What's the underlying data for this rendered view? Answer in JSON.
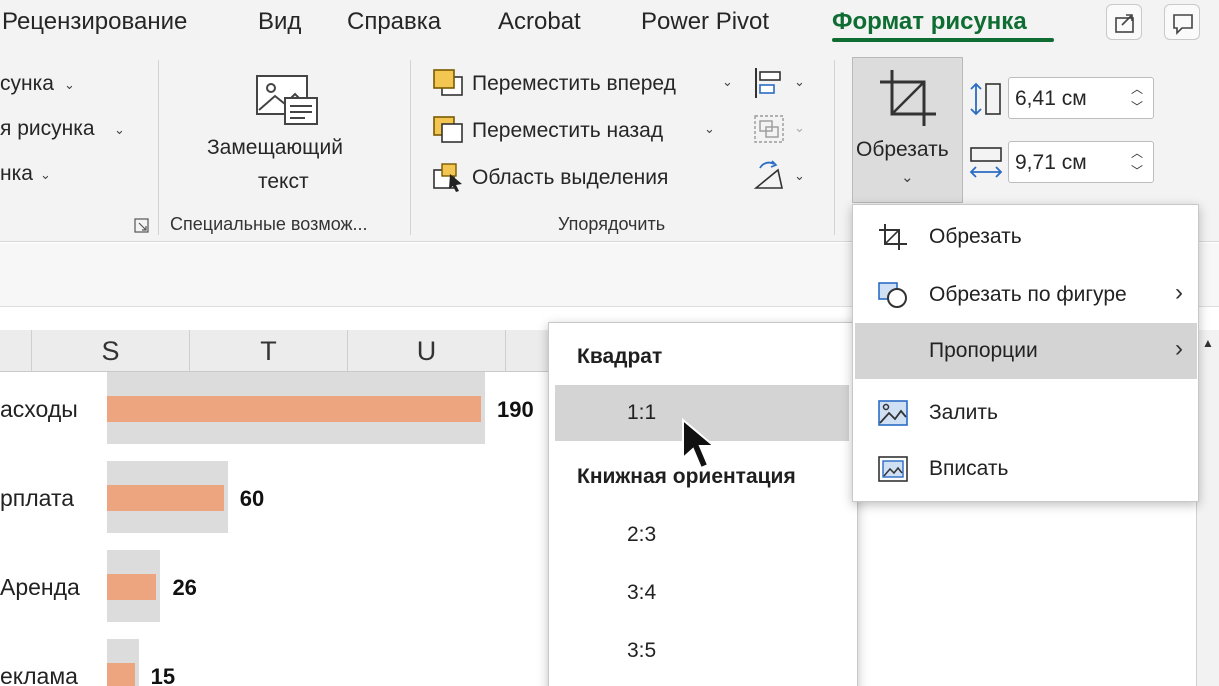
{
  "tabs": [
    {
      "label": "Рецензирование"
    },
    {
      "label": "Вид"
    },
    {
      "label": "Справка"
    },
    {
      "label": "Acrobat"
    },
    {
      "label": "Power Pivot"
    },
    {
      "label": "Формат рисунка"
    }
  ],
  "ribbon": {
    "left_items": [
      "сунка",
      "я рисунка",
      "нка"
    ],
    "alt_text": {
      "line1": "Замещающий",
      "line2": "текст"
    },
    "accessibility_group_label": "Специальные возмож...",
    "arrange": {
      "bring_forward": "Переместить вперед",
      "send_backward": "Переместить назад",
      "selection_pane": "Область выделения",
      "group_label": "Упорядочить"
    },
    "crop_button_label": "Обрезать",
    "height_value": "6,41 см",
    "width_value": "9,71 см"
  },
  "sheet": {
    "columns": [
      "S",
      "T",
      "U"
    ]
  },
  "chart_data": {
    "type": "bar",
    "categories": [
      "асходы",
      "рплата",
      "Аренда",
      "еклама"
    ],
    "values": [
      190,
      60,
      26,
      15
    ],
    "xlim": [
      0,
      190
    ]
  },
  "crop_menu": {
    "items": [
      {
        "label": "Обрезать",
        "icon": "crop-icon",
        "has_submenu": false
      },
      {
        "label": "Обрезать по фигуре",
        "icon": "crop-to-shape-icon",
        "has_submenu": true
      },
      {
        "label": "Пропорции",
        "icon": "",
        "has_submenu": true
      },
      {
        "label": "Залить",
        "icon": "fill-icon",
        "has_submenu": false
      },
      {
        "label": "Вписать",
        "icon": "fit-icon",
        "has_submenu": false
      }
    ]
  },
  "aspect_menu": {
    "square_header": "Квадрат",
    "square_items": [
      "1:1"
    ],
    "portrait_header": "Книжная ориентация",
    "portrait_items": [
      "2:3",
      "3:4",
      "3:5"
    ]
  },
  "colors": {
    "accent": "#0f6c33",
    "bar": "#eda57f",
    "bar_shadow": "#dcdcdc",
    "highlight": "#d4d4d4"
  }
}
